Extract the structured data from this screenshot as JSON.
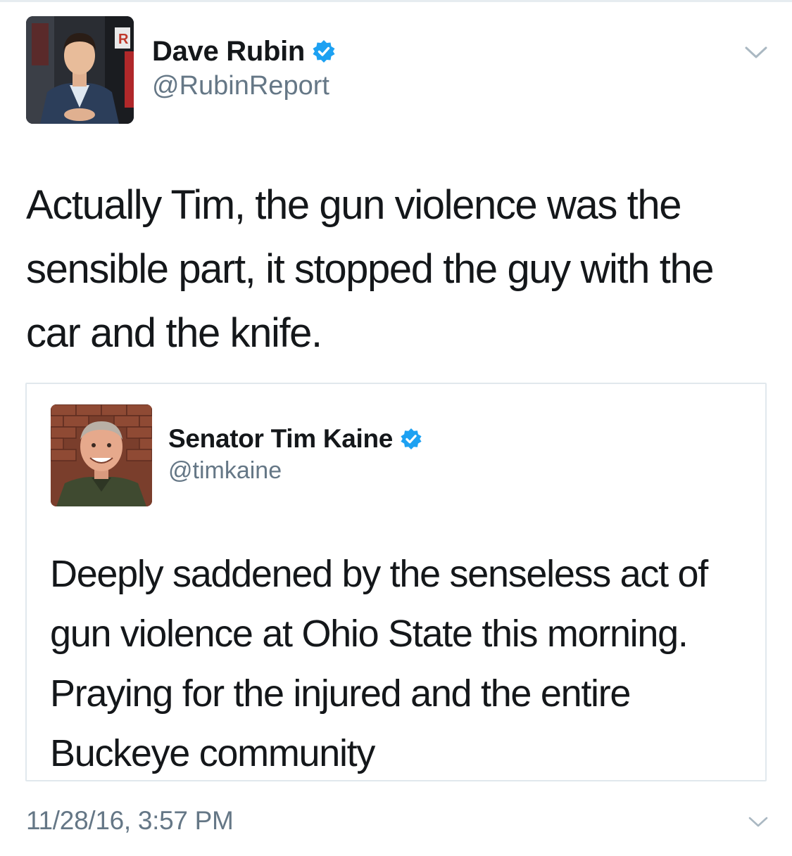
{
  "tweet": {
    "author": {
      "name": "Dave Rubin",
      "handle": "@RubinReport",
      "verified": true,
      "avatar_badge": "R"
    },
    "text": "Actually Tim, the gun violence was the sensible part, it stopped the guy with the car and the knife.",
    "timestamp": "11/28/16, 3:57 PM",
    "menu_icon": "chevron-down-icon"
  },
  "quoted_tweet": {
    "author": {
      "name": "Senator Tim Kaine",
      "handle": "@timkaine",
      "verified": true
    },
    "text": "Deeply saddened by the senseless act of gun violence at Ohio State this morning. Praying for the injured and the entire Buckeye community",
    "menu_icon": "chevron-down-icon"
  },
  "colors": {
    "text_primary": "#14171a",
    "text_secondary": "#657786",
    "verified_blue": "#1da1f2",
    "card_border": "#e1e8ed"
  }
}
